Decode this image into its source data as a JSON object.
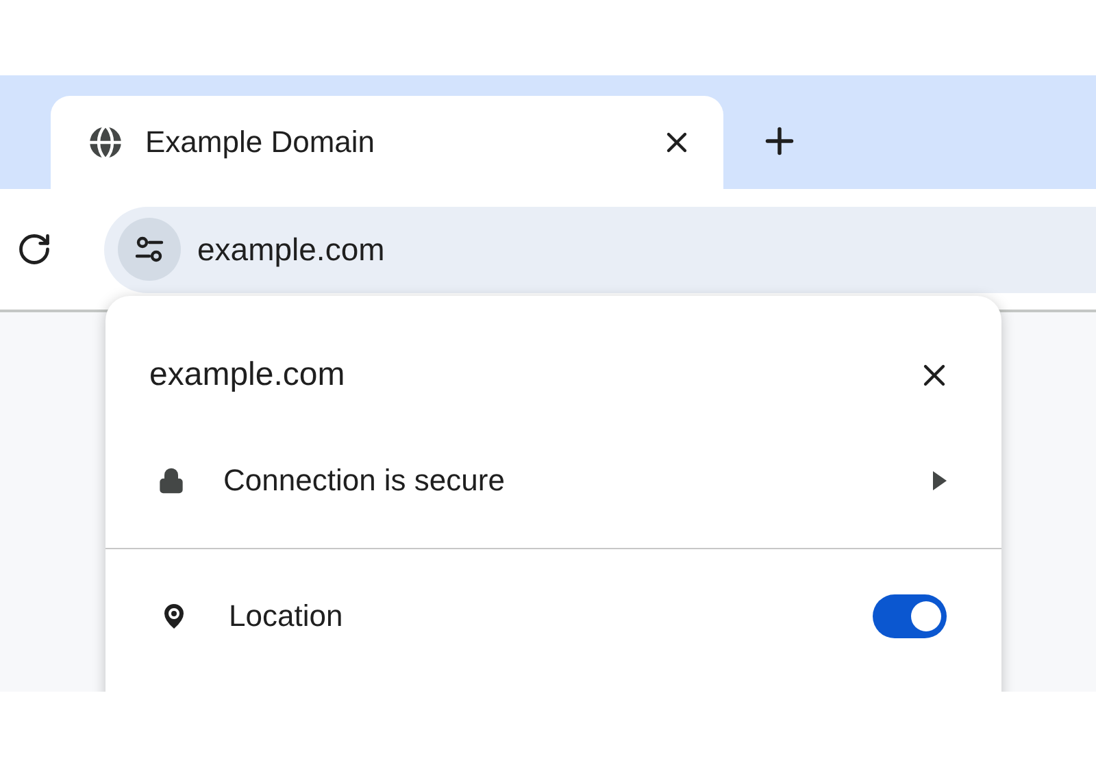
{
  "tab": {
    "title": "Example Domain"
  },
  "address_bar": {
    "value": "example.com"
  },
  "site_info_popup": {
    "title": "example.com",
    "connection": {
      "label": "Connection is secure"
    },
    "permissions": [
      {
        "label": "Location",
        "on": true
      }
    ]
  }
}
